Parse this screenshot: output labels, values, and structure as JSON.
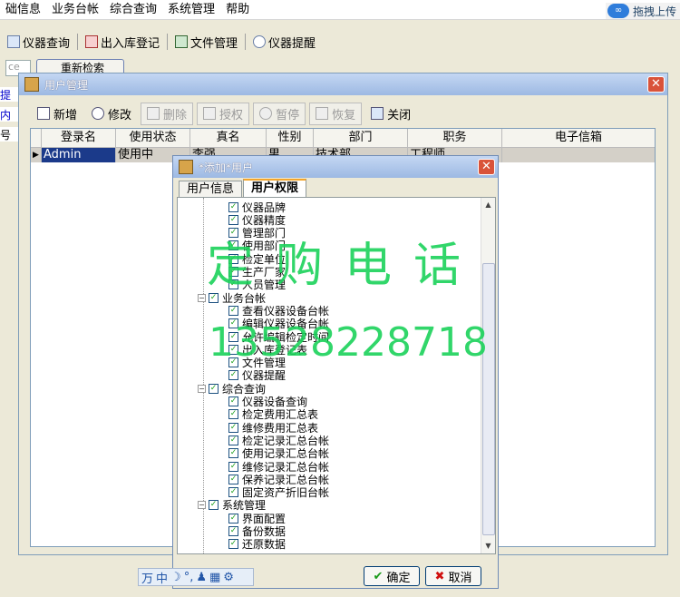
{
  "menubar": {
    "items": [
      "础信息",
      "业务台帐",
      "综合查询",
      "系统管理",
      "帮助"
    ],
    "cloud_label": "拖拽上传"
  },
  "toolbar": {
    "items": [
      "仪器查询",
      "出入库登记",
      "文件管理",
      "仪器提醒"
    ]
  },
  "background": {
    "field_text": "ce",
    "refresh_label": "重新检索",
    "edge_texts": [
      "提",
      "内",
      "号"
    ]
  },
  "user_window": {
    "title": "用户管理",
    "toolbar": {
      "add": "新增",
      "edit": "修改",
      "delete": "删除",
      "grant": "授权",
      "pause": "暂停",
      "restore": "恢复",
      "close": "关闭"
    },
    "grid": {
      "columns": [
        "登录名",
        "使用状态",
        "真名",
        "性别",
        "部门",
        "职务",
        "电子信箱"
      ],
      "rows": [
        [
          "Admin",
          "使用中",
          "李强",
          "男",
          "技术部",
          "工程师",
          ""
        ]
      ]
    }
  },
  "dialog": {
    "title": "*添加*用户",
    "tabs": [
      "用户信息",
      "用户权限"
    ],
    "active_tab": "用户权限",
    "tree": [
      {
        "label": "仪器品牌",
        "level": 2
      },
      {
        "label": "仪器精度",
        "level": 2
      },
      {
        "label": "管理部门",
        "level": 2
      },
      {
        "label": "使用部门",
        "level": 2
      },
      {
        "label": "检定单位",
        "level": 2
      },
      {
        "label": "生产厂家",
        "level": 2
      },
      {
        "label": "人员管理",
        "level": 2
      },
      {
        "label": "业务台帐",
        "level": 1
      },
      {
        "label": "查看仪器设备台帐",
        "level": 2
      },
      {
        "label": "编辑仪器设备台帐",
        "level": 2
      },
      {
        "label": "允许编辑检定时间",
        "level": 2
      },
      {
        "label": "出入库登记表",
        "level": 2
      },
      {
        "label": "文件管理",
        "level": 2
      },
      {
        "label": "仪器提醒",
        "level": 2
      },
      {
        "label": "综合查询",
        "level": 1
      },
      {
        "label": "仪器设备查询",
        "level": 2
      },
      {
        "label": "检定费用汇总表",
        "level": 2
      },
      {
        "label": "维修费用汇总表",
        "level": 2
      },
      {
        "label": "检定记录汇总台帐",
        "level": 2
      },
      {
        "label": "使用记录汇总台帐",
        "level": 2
      },
      {
        "label": "维修记录汇总台帐",
        "level": 2
      },
      {
        "label": "保养记录汇总台帐",
        "level": 2
      },
      {
        "label": "固定资产折旧台帐",
        "level": 2
      },
      {
        "label": "系统管理",
        "level": 1
      },
      {
        "label": "界面配置",
        "level": 2
      },
      {
        "label": "备份数据",
        "level": 2
      },
      {
        "label": "还原数据",
        "level": 2
      }
    ],
    "ok_label": "确定",
    "cancel_label": "取消"
  },
  "watermark": {
    "line1": "定购电话",
    "line2": "13528228718"
  },
  "ime": {
    "mode": "中"
  }
}
